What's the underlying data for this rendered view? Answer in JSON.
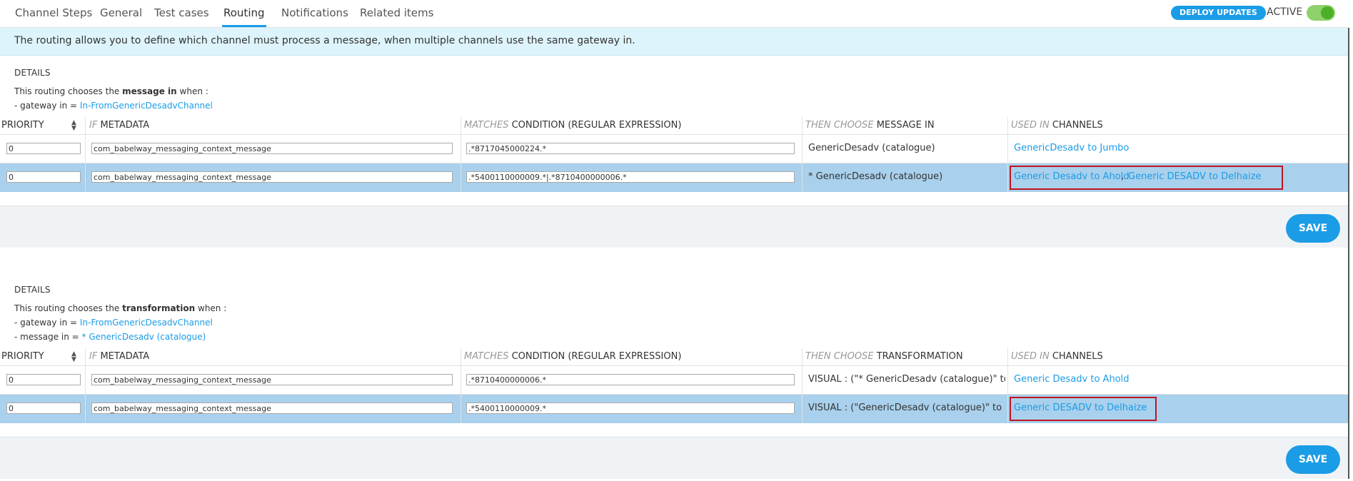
{
  "tabs": [
    {
      "label": "Channel Steps"
    },
    {
      "label": "General"
    },
    {
      "label": "Test cases"
    },
    {
      "label": "Routing"
    },
    {
      "label": "Notifications"
    },
    {
      "label": "Related items"
    }
  ],
  "header": {
    "deploy_label": "DEPLOY UPDATES",
    "active_label": "ACTIVE",
    "active_on": true
  },
  "banner": "The routing allows you to define which channel must process a message, when multiple channels use the same gateway in.",
  "section1": {
    "title": "DETAILS",
    "desc_prefix": "This routing chooses the ",
    "desc_bold": "message in",
    "desc_suffix": " when :",
    "cond1_label": "- gateway in = ",
    "cond1_value": "In-FromGenericDesadvChannel",
    "headers": {
      "priority": "PRIORITY",
      "meta_pre": "IF",
      "meta": "METADATA",
      "cond_pre": "MATCHES",
      "cond": "CONDITION (REGULAR EXPRESSION)",
      "then_pre": "THEN CHOOSE",
      "then": "MESSAGE IN",
      "used_pre": "USED IN",
      "used": "CHANNELS"
    },
    "rows": [
      {
        "priority": "0",
        "metadata": "com_babelway_messaging_context_message",
        "condition": ".*8717045000224.*",
        "then": "GenericDesadv (catalogue)",
        "channel1": "GenericDesadv to Jumbo",
        "sep": "",
        "channel2": ""
      },
      {
        "priority": "0",
        "metadata": "com_babelway_messaging_context_message",
        "condition": ".*5400110000009.*|.*8710400000006.*",
        "then": "* GenericDesadv (catalogue)",
        "channel1": "Generic Desadv to Ahold",
        "sep": ",",
        "channel2": "Generic DESADV to Delhaize"
      }
    ],
    "save_label": "SAVE"
  },
  "section2": {
    "title": "DETAILS",
    "desc_prefix": "This routing chooses the ",
    "desc_bold": "transformation",
    "desc_suffix": " when :",
    "cond1_label": "- gateway in = ",
    "cond1_value": "In-FromGenericDesadvChannel",
    "cond2_label": "- message in = ",
    "cond2_value": "* GenericDesadv (catalogue)",
    "headers": {
      "priority": "PRIORITY",
      "meta_pre": "IF",
      "meta": "METADATA",
      "cond_pre": "MATCHES",
      "cond": "CONDITION (REGULAR EXPRESSION)",
      "then_pre": "THEN CHOOSE",
      "then": "TRANSFORMATION",
      "used_pre": "USED IN",
      "used": "CHANNELS"
    },
    "rows": [
      {
        "priority": "0",
        "metadata": "com_babelway_messaging_context_message",
        "condition": ".*8710400000006.*",
        "then": "VISUAL : (\"* GenericDesadv (catalogue)\" to \"Ed",
        "channel1": "Generic Desadv to Ahold"
      },
      {
        "priority": "0",
        "metadata": "com_babelway_messaging_context_message",
        "condition": ".*5400110000009.*",
        "then": "VISUAL : (\"GenericDesadv (catalogue)\" to \"Edif",
        "channel1": "Generic DESADV to Delhaize"
      }
    ],
    "save_label": "SAVE"
  }
}
